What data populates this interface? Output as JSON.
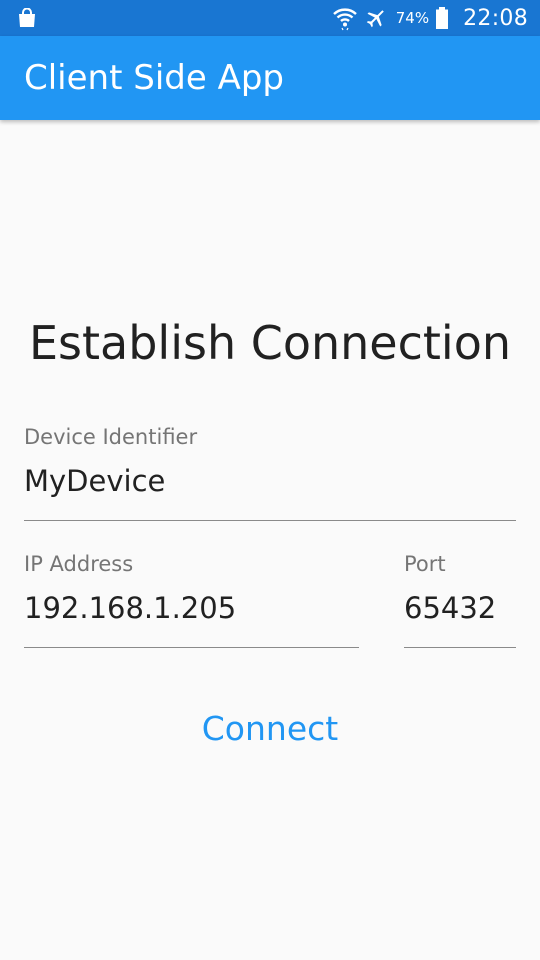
{
  "status_bar": {
    "left_icon": "shopping-bag-icon",
    "icons": [
      "wifi-icon",
      "airplane-mode-icon"
    ],
    "battery_percent": "74%",
    "battery_icon": "battery-icon",
    "time": "22:08"
  },
  "app_bar": {
    "title": "Client Side App"
  },
  "main": {
    "heading": "Establish Connection",
    "device_field": {
      "label": "Device Identifier",
      "value": "MyDevice"
    },
    "ip_field": {
      "label": "IP Address",
      "value": "192.168.1.205"
    },
    "port_field": {
      "label": "Port",
      "value": "65432"
    },
    "connect_label": "Connect"
  },
  "colors": {
    "status_bar": "#1976d2",
    "app_bar": "#2196f3",
    "accent": "#2196f3",
    "background": "#fafafa"
  }
}
